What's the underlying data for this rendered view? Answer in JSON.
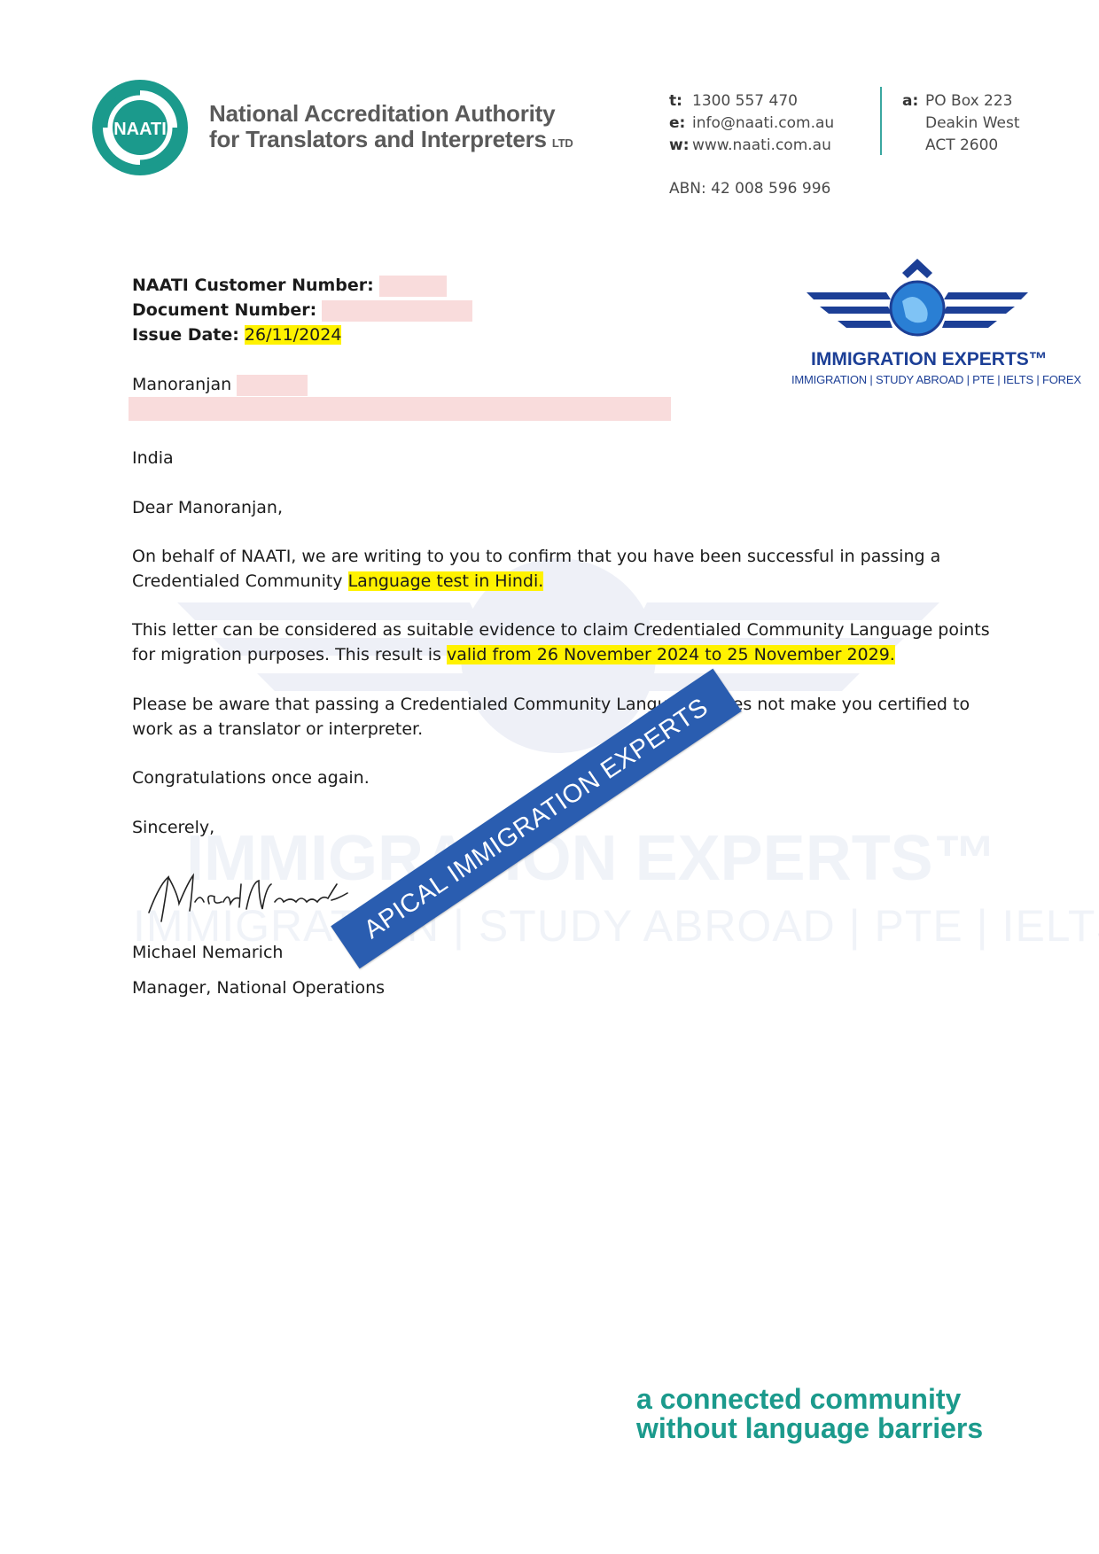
{
  "header": {
    "org_name_line1": "National Accreditation Authority",
    "org_name_line2": "for Translators and Interpreters",
    "org_suffix": "LTD",
    "logo_text": "NAATI",
    "contact": [
      {
        "key": "t:",
        "value": "1300 557 470"
      },
      {
        "key": "e:",
        "value": "info@naati.com.au"
      },
      {
        "key": "w:",
        "value": "www.naati.com.au"
      }
    ],
    "address_key": "a:",
    "address_lines": [
      "PO Box 223",
      "Deakin West",
      "ACT 2600"
    ],
    "abn": "ABN: 42 008 596 996"
  },
  "watermark_logo": {
    "title": "IMMIGRATION EXPERTS™",
    "subtitle": "IMMIGRATION | STUDY ABROAD | PTE | IELTS | FOREX",
    "ribbon": "APICAL IMMIGRATION EXPERTS"
  },
  "letter": {
    "customer_number_label": "NAATI Customer Number:",
    "document_number_label": "Document Number:",
    "issue_date_label": "Issue Date:",
    "issue_date": "26/11/2024",
    "recipient_first_name": "Manoranjan",
    "country": "India",
    "salutation": "Dear Manoranjan,",
    "para1_line1": "On behalf of NAATI, we are writing to you to confirm that you have been successful in passing a",
    "para1_line2_pre": "Credentialed Community ",
    "para1_line2_hl": "Language test in Hindi.",
    "para2_line1": "This letter can be considered as suitable evidence to claim Credentialed Community Language points",
    "para2_line2_pre": "for migration purposes. This result is ",
    "para2_line2_hl": "valid from 26 November 2024 to 25 November 2029.",
    "para3_line1": "Please be aware that passing a Credentialed Community Langua",
    "para3_line1_end": "oes not make you certified to",
    "para3_line2": "work as a translator or interpreter.",
    "closing1": "Congratulations once again.",
    "closing2": "Sincerely,",
    "signer_name": "Michael Nemarich",
    "signer_title": "Manager, National Operations"
  },
  "footer": {
    "tagline_line1": "a connected community",
    "tagline_line2": "without language barriers"
  },
  "colors": {
    "naati_teal": "#1b9a8c",
    "immigration_blue": "#1c3f96",
    "highlight": "#fff200",
    "redaction": "#f9dcdc"
  }
}
